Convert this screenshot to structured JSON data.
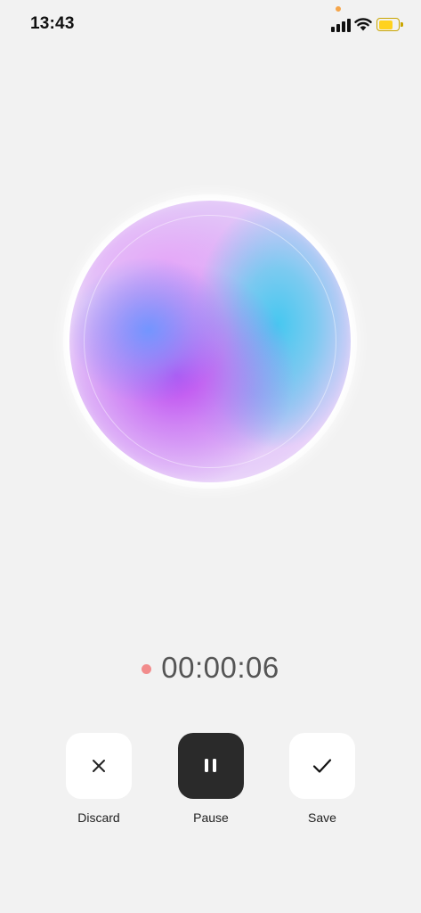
{
  "status_bar": {
    "time": "13:43",
    "signal_icon": "cellular-signal-icon",
    "wifi_icon": "wifi-icon",
    "battery_icon": "battery-icon",
    "battery_level": 0.75,
    "battery_color": "#ffd21f",
    "mic_indicator_color": "#f5a54a"
  },
  "visualizer": {
    "type": "gradient-orb",
    "colors": [
      "#ba40f0",
      "#6e96ff",
      "#46c8f0",
      "#e6a0f8"
    ]
  },
  "recording": {
    "indicator_color": "#f28c8c",
    "elapsed": "00:00:06"
  },
  "controls": {
    "discard": {
      "label": "Discard",
      "icon": "close-icon"
    },
    "pause": {
      "label": "Pause",
      "icon": "pause-icon",
      "background": "#2a2a2a"
    },
    "save": {
      "label": "Save",
      "icon": "checkmark-icon"
    }
  }
}
